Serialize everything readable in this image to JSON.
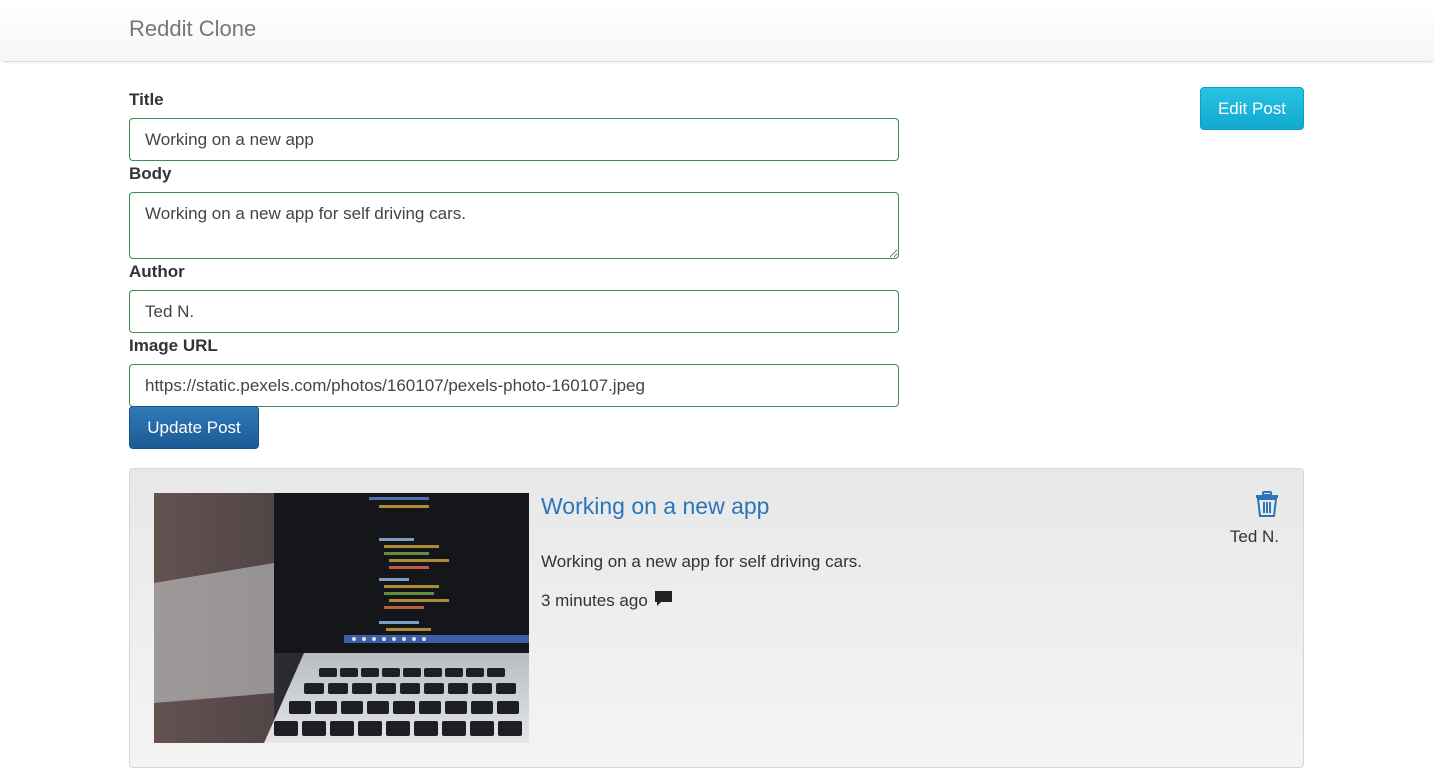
{
  "navbar": {
    "brand": "Reddit Clone"
  },
  "form": {
    "title_label": "Title",
    "title_value": "Working on a new app",
    "body_label": "Body",
    "body_value": "Working on a new app for self driving cars.",
    "author_label": "Author",
    "author_value": "Ted N.",
    "image_label": "Image URL",
    "image_value": "https://static.pexels.com/photos/160107/pexels-photo-160107.jpeg",
    "submit_label": "Update Post"
  },
  "actions": {
    "edit_label": "Edit Post"
  },
  "post": {
    "title": "Working on a new app",
    "body": "Working on a new app for self driving cars.",
    "time": "3 minutes ago",
    "author": "Ted N.",
    "image_icon": "laptop-code-photo",
    "delete_icon": "trash-icon",
    "comment_icon": "comment-icon"
  },
  "colors": {
    "accent_link": "#2a76b8",
    "info_button": "#12a9cf",
    "primary_button": "#1c5a96",
    "input_border": "#3c8c4a"
  }
}
